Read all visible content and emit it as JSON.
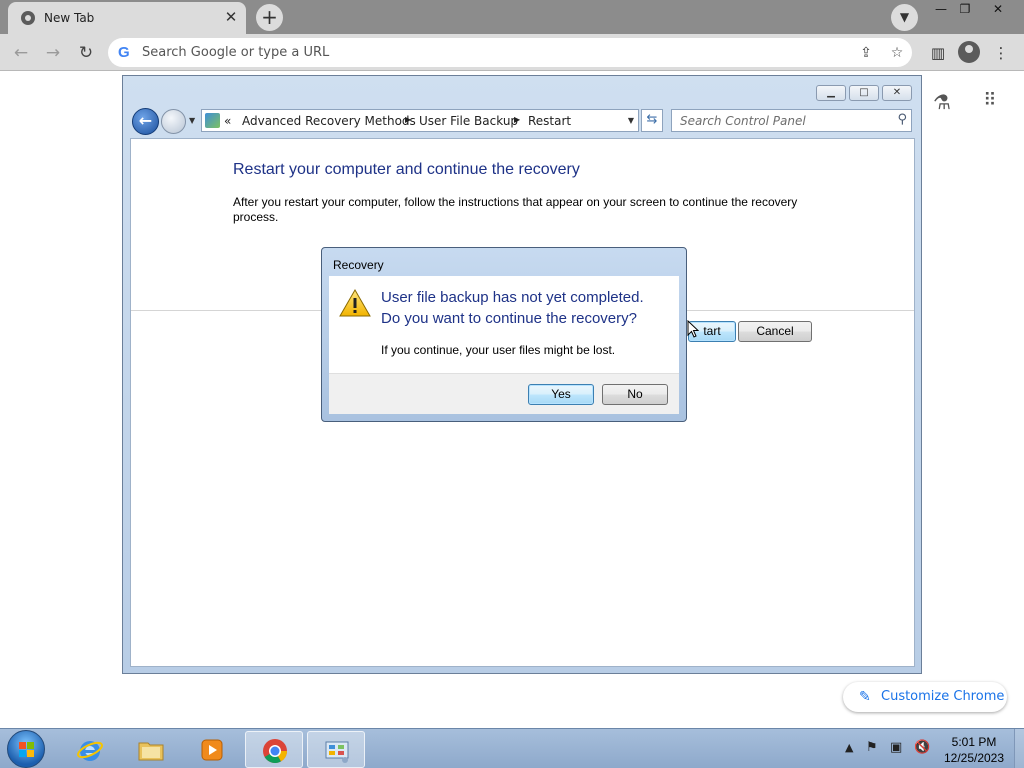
{
  "browser": {
    "tab_title": "New Tab",
    "tab_close": "✕",
    "new_tab": "+",
    "omnibox_placeholder": "Search Google or type a URL",
    "google_g": "G",
    "customize_label": "Customize Chrome",
    "icons": [
      "tab-search-icon",
      "minimize-icon",
      "restore-icon",
      "close-icon",
      "back-icon",
      "forward-icon",
      "reload-icon",
      "share-icon",
      "star-icon",
      "side-panel-icon",
      "profile-icon",
      "menu-icon",
      "labs-icon",
      "apps-grid-icon",
      "pencil-icon"
    ]
  },
  "control_panel": {
    "breadcrumb_lead": "«",
    "breadcrumbs": [
      "Advanced Recovery Methods",
      "User File Backup",
      "Restart"
    ],
    "search_placeholder": "Search Control Panel",
    "heading": "Restart your computer and continue the recovery",
    "description": "After you restart your computer, follow the instructions that appear on your screen to continue the recovery process.",
    "restart_button": "Restart",
    "restart_visible": "tart",
    "cancel_button": "Cancel"
  },
  "dialog": {
    "title": "Recovery",
    "message_line1": "User file backup has not yet completed.",
    "message_line2": "Do you want to continue the recovery?",
    "submessage": "If you continue, your user files might be lost.",
    "yes_button": "Yes",
    "no_button": "No"
  },
  "taskbar": {
    "items": [
      "Internet Explorer",
      "Windows Explorer",
      "Windows Media Player",
      "Google Chrome",
      "Control Panel"
    ],
    "time": "5:01 PM",
    "date": "12/25/2023"
  },
  "colors": {
    "heading_blue": "#1e3287",
    "chrome_accent": "#1a73e8",
    "taskbar": "#9db6d6"
  }
}
